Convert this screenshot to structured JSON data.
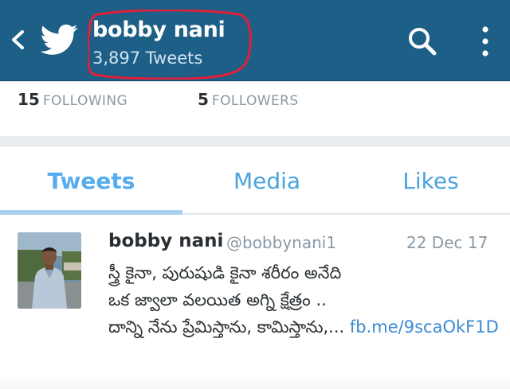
{
  "header": {
    "name": "bobby nani",
    "tweet_count": "3,897 Tweets",
    "back_icon": "chevron-left-icon",
    "logo_icon": "twitter-bird-icon",
    "search_icon": "search-icon",
    "menu_icon": "more-vertical-icon",
    "background": "#1d5f87",
    "annotation_color": "#e0203a"
  },
  "stats": {
    "following_count": "15",
    "following_label": "FOLLOWING",
    "followers_count": "5",
    "followers_label": "FOLLOWERS"
  },
  "tabs": [
    {
      "label": "Tweets",
      "active": true
    },
    {
      "label": "Media",
      "active": false
    },
    {
      "label": "Likes",
      "active": false
    }
  ],
  "tweet": {
    "author": "bobby nani",
    "handle": "@bobbynani1",
    "date": "22 Dec 17",
    "line1": "స్త్రీ కైనా, పురుషుడి కైనా శరీరం అనేది",
    "line2": "ఒక జ్వాలా వలయిత అగ్ని క్షేత్రం ..",
    "line3": "దాన్ని నేను ప్రేమిస్తాను, కామిస్తాను,...",
    "link": "fb.me/9scaOkF1D",
    "link_color": "#3a8ad1"
  }
}
